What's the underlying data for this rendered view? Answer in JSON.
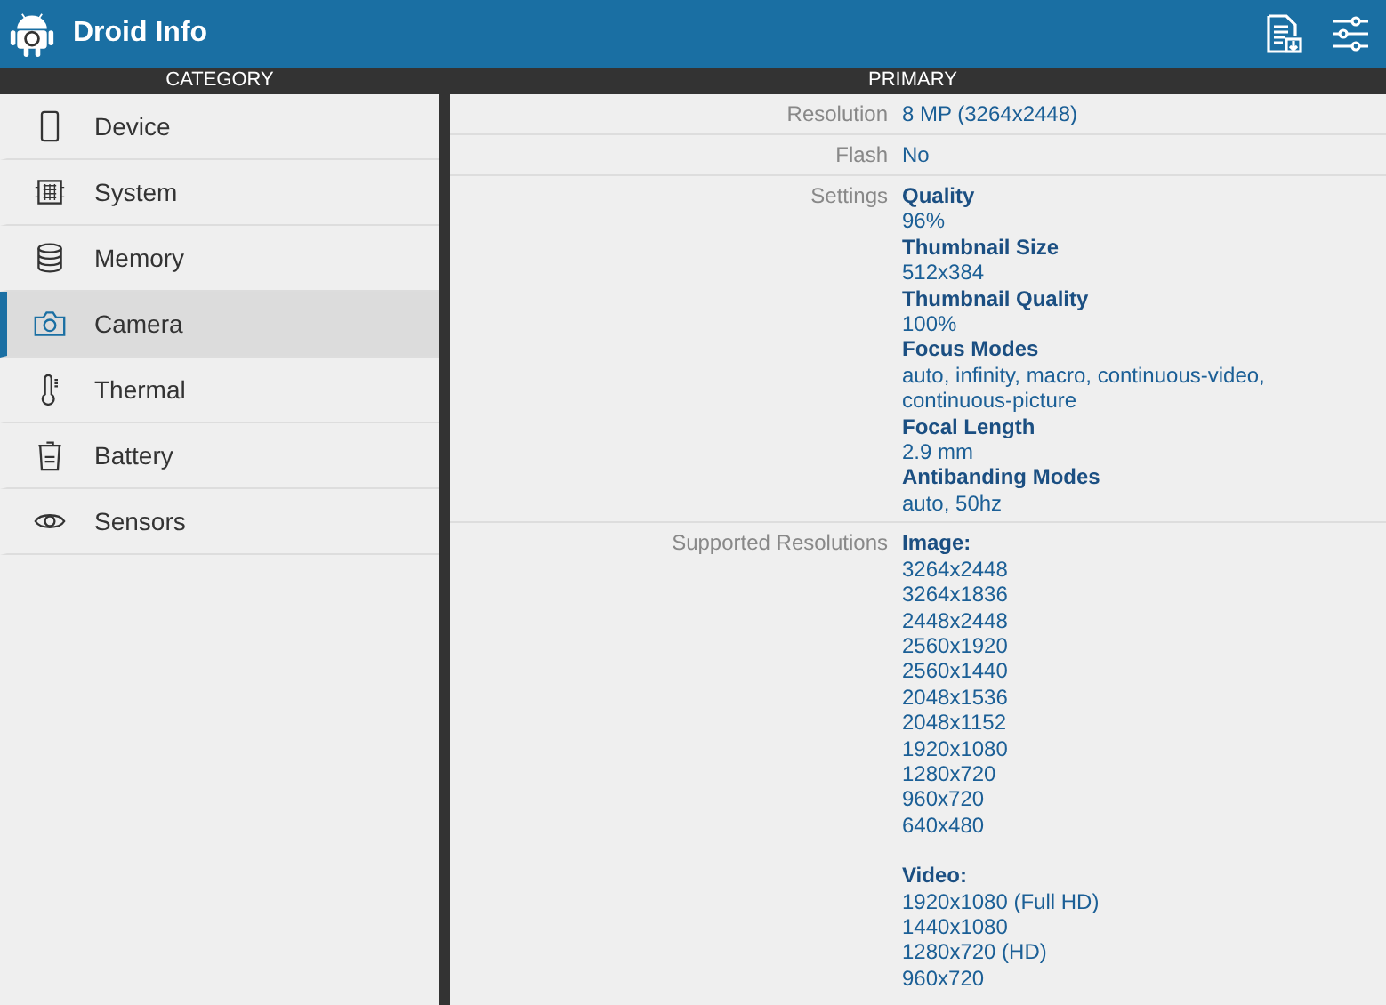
{
  "app_bar": {
    "title": "Droid Info"
  },
  "columns": {
    "left": "CATEGORY",
    "right": "PRIMARY"
  },
  "categories": [
    {
      "label": "Device",
      "kind": "phone",
      "selected": false
    },
    {
      "label": "System",
      "kind": "chip",
      "selected": false
    },
    {
      "label": "Memory",
      "kind": "database",
      "selected": false
    },
    {
      "label": "Camera",
      "kind": "camera",
      "selected": true
    },
    {
      "label": "Thermal",
      "kind": "thermometer",
      "selected": false
    },
    {
      "label": "Battery",
      "kind": "trash",
      "selected": false
    },
    {
      "label": "Sensors",
      "kind": "eye",
      "selected": false
    }
  ],
  "details": [
    {
      "label": "Resolution",
      "kind": "text",
      "value": "8 MP (3264x2448)"
    },
    {
      "label": "Flash",
      "kind": "text",
      "value": "No"
    },
    {
      "label": "Settings",
      "kind": "pairs",
      "items": [
        {
          "title": "Quality",
          "value": "96%"
        },
        {
          "title": "Thumbnail Size",
          "value": "512x384"
        },
        {
          "title": "Thumbnail Quality",
          "value": "100%"
        },
        {
          "title": "Focus Modes",
          "value": "auto, infinity, macro, continuous-video, continuous-picture"
        },
        {
          "title": "Focal Length",
          "value": "2.9 mm"
        },
        {
          "title": "Antibanding Modes",
          "value": "auto, 50hz"
        }
      ]
    },
    {
      "label": "Supported Resolutions",
      "kind": "groups",
      "groups": [
        {
          "title": "Image:",
          "values": [
            "3264x2448",
            "3264x1836",
            "2448x2448",
            "2560x1920",
            "2560x1440",
            "2048x1536",
            "2048x1152",
            "1920x1080",
            "1280x720",
            "960x720",
            "640x480"
          ]
        },
        {
          "title": "Video:",
          "values": [
            "1920x1080 (Full HD)",
            "1440x1080",
            "1280x720 (HD)",
            "960x720"
          ]
        }
      ]
    }
  ]
}
